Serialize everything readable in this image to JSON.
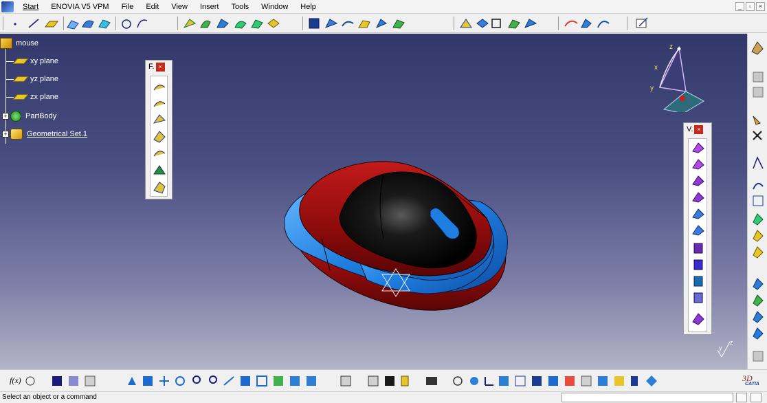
{
  "menubar": {
    "items": [
      "Start",
      "ENOVIA V5 VPM",
      "File",
      "Edit",
      "View",
      "Insert",
      "Tools",
      "Window",
      "Help"
    ]
  },
  "tree": {
    "root": "mouse",
    "nodes": [
      "xy plane",
      "yz plane",
      "zx plane",
      "PartBody",
      "Geometrical Set.1"
    ]
  },
  "palettes": {
    "left_title": "F.",
    "right_title": "V.",
    "close_glyph": "×"
  },
  "compass": {
    "x": "x",
    "y": "y",
    "z": "z"
  },
  "axis_small": {
    "y": "y",
    "z": "z"
  },
  "bottom": {
    "fx_label": "f(x)"
  },
  "status": {
    "text": "Select an object or a command"
  },
  "brand": {
    "catia": "CATIA"
  },
  "colors": {
    "viewport_top": "#33386a",
    "viewport_bottom": "#b4b3c6",
    "mouse_red": "#8c0b0b",
    "mouse_blue": "#1f7fe0",
    "mouse_black": "#0a0a0a"
  }
}
